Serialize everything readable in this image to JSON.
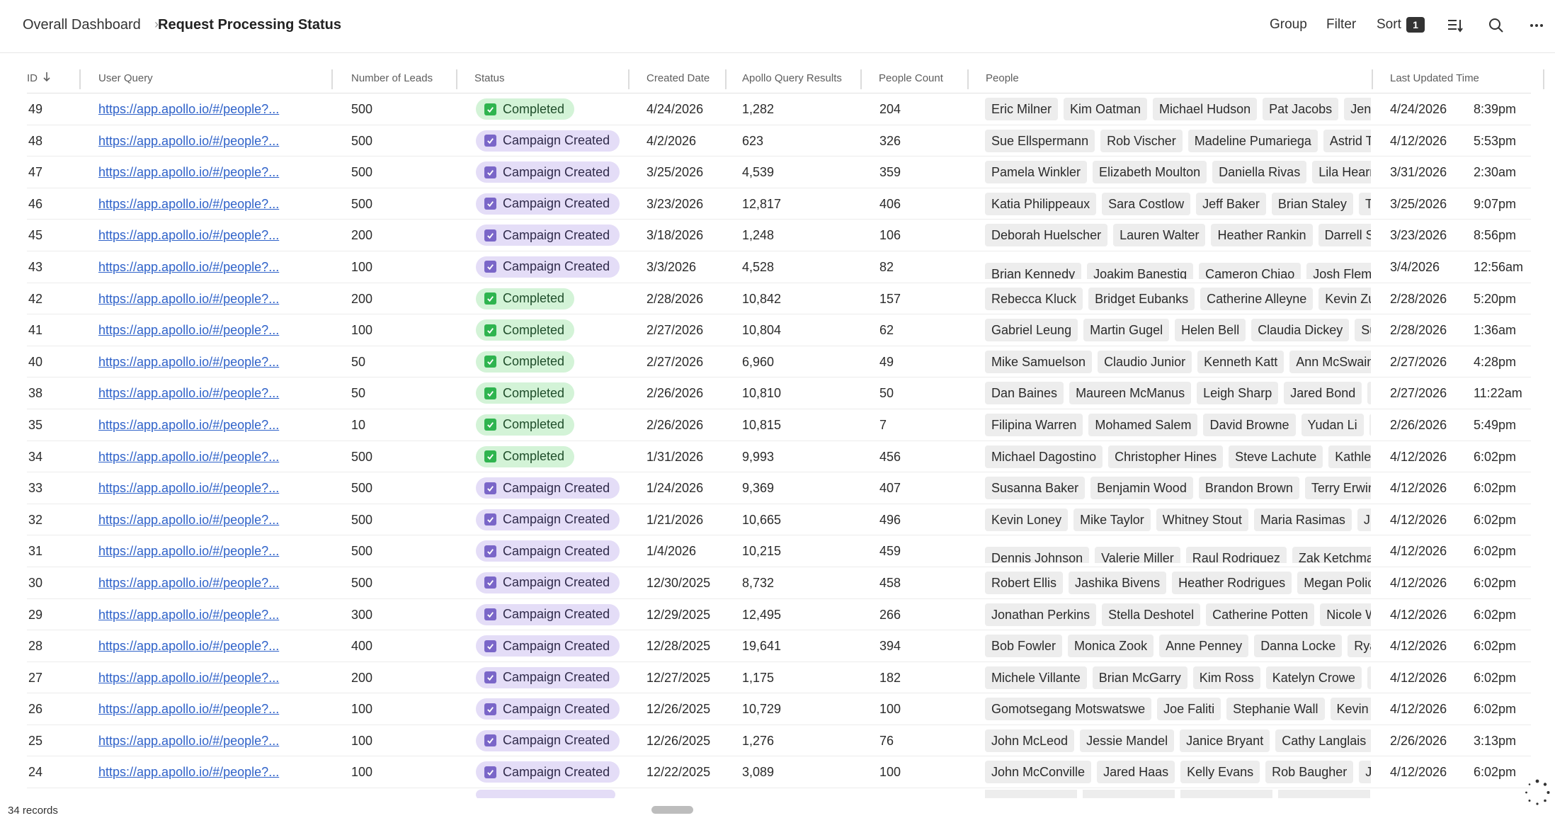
{
  "breadcrumb": {
    "root": "Overall Dashboard",
    "separator": "›",
    "current": "Request Processing Status"
  },
  "toolbar": {
    "group": "Group",
    "filter": "Filter",
    "sort": "Sort",
    "sort_count": "1",
    "icons": [
      "row-height-icon",
      "search-icon",
      "more-icon"
    ]
  },
  "table": {
    "columns": [
      "ID",
      "User Query",
      "Number of Leads",
      "Status",
      "Created Date",
      "Apollo Query Results",
      "People Count",
      "People",
      "Last Updated Time"
    ],
    "rows": [
      {
        "id": "49",
        "query": "https://app.apollo.io/#/people?...",
        "leads": "500",
        "status": "Completed",
        "created": "4/24/2026",
        "results": "1,282",
        "count": "204",
        "people": [
          "Eric Milner",
          "Kim Oatman",
          "Michael Hudson",
          "Pat Jacobs",
          "Jenna Ca"
        ],
        "updated_date": "4/24/2026",
        "updated_time": "8:39pm"
      },
      {
        "id": "48",
        "query": "https://app.apollo.io/#/people?...",
        "leads": "500",
        "status": "Campaign Created",
        "created": "4/2/2026",
        "results": "623",
        "count": "326",
        "people": [
          "Sue Ellspermann",
          "Rob Vischer",
          "Madeline Pumariega",
          "Astrid Tumir"
        ],
        "updated_date": "4/12/2026",
        "updated_time": "5:53pm"
      },
      {
        "id": "47",
        "query": "https://app.apollo.io/#/people?...",
        "leads": "500",
        "status": "Campaign Created",
        "created": "3/25/2026",
        "results": "4,539",
        "count": "359",
        "people": [
          "Pamela Winkler",
          "Elizabeth Moulton",
          "Daniella Rivas",
          "Lila Hearn",
          "P"
        ],
        "updated_date": "3/31/2026",
        "updated_time": "2:30am"
      },
      {
        "id": "46",
        "query": "https://app.apollo.io/#/people?...",
        "leads": "500",
        "status": "Campaign Created",
        "created": "3/23/2026",
        "results": "12,817",
        "count": "406",
        "people": [
          "Katia Philippeaux",
          "Sara Costlow",
          "Jeff Baker",
          "Brian Staley",
          "Tyler Ja"
        ],
        "updated_date": "3/25/2026",
        "updated_time": "9:07pm"
      },
      {
        "id": "45",
        "query": "https://app.apollo.io/#/people?...",
        "leads": "200",
        "status": "Campaign Created",
        "created": "3/18/2026",
        "results": "1,248",
        "count": "106",
        "people": [
          "Deborah Huelscher",
          "Lauren Walter",
          "Heather Rankin",
          "Darrell Stinch"
        ],
        "updated_date": "3/23/2026",
        "updated_time": "8:56pm"
      },
      {
        "id": "43",
        "query": "https://app.apollo.io/#/people?...",
        "leads": "100",
        "status": "Campaign Created",
        "created": "3/3/2026",
        "results": "4,528",
        "count": "82",
        "people": [
          "Brian Kennedy",
          "Joakim Banestig",
          "Cameron Chiao",
          "Josh Fleming",
          ""
        ],
        "updated_date": "3/4/2026",
        "updated_time": "12:56am"
      },
      {
        "id": "42",
        "query": "https://app.apollo.io/#/people?...",
        "leads": "200",
        "status": "Completed",
        "created": "2/28/2026",
        "results": "10,842",
        "count": "157",
        "people": [
          "Rebecca Kluck",
          "Bridget Eubanks",
          "Catherine Alleyne",
          "Kevin Zuchor"
        ],
        "updated_date": "2/28/2026",
        "updated_time": "5:20pm"
      },
      {
        "id": "41",
        "query": "https://app.apollo.io/#/people?...",
        "leads": "100",
        "status": "Completed",
        "created": "2/27/2026",
        "results": "10,804",
        "count": "62",
        "people": [
          "Gabriel Leung",
          "Martin Gugel",
          "Helen Bell",
          "Claudia Dickey",
          "Susan"
        ],
        "updated_date": "2/28/2026",
        "updated_time": "1:36am"
      },
      {
        "id": "40",
        "query": "https://app.apollo.io/#/people?...",
        "leads": "50",
        "status": "Completed",
        "created": "2/27/2026",
        "results": "6,960",
        "count": "49",
        "people": [
          "Mike Samuelson",
          "Claudio Junior",
          "Kenneth Katt",
          "Ann McSwain",
          "J"
        ],
        "updated_date": "2/27/2026",
        "updated_time": "4:28pm"
      },
      {
        "id": "38",
        "query": "https://app.apollo.io/#/people?...",
        "leads": "50",
        "status": "Completed",
        "created": "2/26/2026",
        "results": "10,810",
        "count": "50",
        "people": [
          "Dan Baines",
          "Maureen McManus",
          "Leigh Sharp",
          "Jared Bond",
          "Firoz"
        ],
        "updated_date": "2/27/2026",
        "updated_time": "11:22am"
      },
      {
        "id": "35",
        "query": "https://app.apollo.io/#/people?...",
        "leads": "10",
        "status": "Completed",
        "created": "2/26/2026",
        "results": "10,815",
        "count": "7",
        "people": [
          "Filipina Warren",
          "Mohamed Salem",
          "David Browne",
          "Yudan Li",
          "Allis"
        ],
        "updated_date": "2/26/2026",
        "updated_time": "5:49pm"
      },
      {
        "id": "34",
        "query": "https://app.apollo.io/#/people?...",
        "leads": "500",
        "status": "Completed",
        "created": "1/31/2026",
        "results": "9,993",
        "count": "456",
        "people": [
          "Michael Dagostino",
          "Christopher Hines",
          "Steve Lachute",
          "Kathleen M"
        ],
        "updated_date": "4/12/2026",
        "updated_time": "6:02pm"
      },
      {
        "id": "33",
        "query": "https://app.apollo.io/#/people?...",
        "leads": "500",
        "status": "Campaign Created",
        "created": "1/24/2026",
        "results": "9,369",
        "count": "407",
        "people": [
          "Susanna Baker",
          "Benjamin Wood",
          "Brandon Brown",
          "Terry Erwin",
          "Jo"
        ],
        "updated_date": "4/12/2026",
        "updated_time": "6:02pm"
      },
      {
        "id": "32",
        "query": "https://app.apollo.io/#/people?...",
        "leads": "500",
        "status": "Campaign Created",
        "created": "1/21/2026",
        "results": "10,665",
        "count": "496",
        "people": [
          "Kevin Loney",
          "Mike Taylor",
          "Whitney Stout",
          "Maria Rasimas",
          "Judy F"
        ],
        "updated_date": "4/12/2026",
        "updated_time": "6:02pm"
      },
      {
        "id": "31",
        "query": "https://app.apollo.io/#/people?...",
        "leads": "500",
        "status": "Campaign Created",
        "created": "1/4/2026",
        "results": "10,215",
        "count": "459",
        "people": [
          "Dennis Johnson",
          "Valerie Miller",
          "Raul Rodriguez",
          "Zak Ketchmark",
          ""
        ],
        "updated_date": "4/12/2026",
        "updated_time": "6:02pm"
      },
      {
        "id": "30",
        "query": "https://app.apollo.io/#/people?...",
        "leads": "500",
        "status": "Campaign Created",
        "created": "12/30/2025",
        "results": "8,732",
        "count": "458",
        "people": [
          "Robert Ellis",
          "Jashika Bivens",
          "Heather Rodrigues",
          "Megan Policicchio"
        ],
        "updated_date": "4/12/2026",
        "updated_time": "6:02pm"
      },
      {
        "id": "29",
        "query": "https://app.apollo.io/#/people?...",
        "leads": "300",
        "status": "Campaign Created",
        "created": "12/29/2025",
        "results": "12,495",
        "count": "266",
        "people": [
          "Jonathan Perkins",
          "Stella Deshotel",
          "Catherine Potten",
          "Nicole Wyse"
        ],
        "updated_date": "4/12/2026",
        "updated_time": "6:02pm"
      },
      {
        "id": "28",
        "query": "https://app.apollo.io/#/people?...",
        "leads": "400",
        "status": "Campaign Created",
        "created": "12/28/2025",
        "results": "19,641",
        "count": "394",
        "people": [
          "Bob Fowler",
          "Monica Zook",
          "Anne Penney",
          "Danna Locke",
          "Ryan Sn"
        ],
        "updated_date": "4/12/2026",
        "updated_time": "6:02pm"
      },
      {
        "id": "27",
        "query": "https://app.apollo.io/#/people?...",
        "leads": "200",
        "status": "Campaign Created",
        "created": "12/27/2025",
        "results": "1,175",
        "count": "182",
        "people": [
          "Michele Villante",
          "Brian McGarry",
          "Kim Ross",
          "Katelyn Crowe",
          "Jim M"
        ],
        "updated_date": "4/12/2026",
        "updated_time": "6:02pm"
      },
      {
        "id": "26",
        "query": "https://app.apollo.io/#/people?...",
        "leads": "100",
        "status": "Campaign Created",
        "created": "12/26/2025",
        "results": "10,729",
        "count": "100",
        "people": [
          "Gomotsegang Motswatswe",
          "Joe Faliti",
          "Stephanie Wall",
          "Kevin Haag"
        ],
        "updated_date": "4/12/2026",
        "updated_time": "6:02pm"
      },
      {
        "id": "25",
        "query": "https://app.apollo.io/#/people?...",
        "leads": "100",
        "status": "Campaign Created",
        "created": "12/26/2025",
        "results": "1,276",
        "count": "76",
        "people": [
          "John McLeod",
          "Jessie Mandel",
          "Janice Bryant",
          "Cathy Langlais",
          "Jose"
        ],
        "updated_date": "2/26/2026",
        "updated_time": "3:13pm"
      },
      {
        "id": "24",
        "query": "https://app.apollo.io/#/people?...",
        "leads": "100",
        "status": "Campaign Created",
        "created": "12/22/2025",
        "results": "3,089",
        "count": "100",
        "people": [
          "John McConville",
          "Jared Haas",
          "Kelly Evans",
          "Rob Baugher",
          "Jason W"
        ],
        "updated_date": "4/12/2026",
        "updated_time": "6:02pm"
      }
    ]
  },
  "footer": {
    "records": "34 records"
  },
  "colors": {
    "completed_bg": "#d3f3d7",
    "completed_check": "#2fb44f",
    "campaign_bg": "#e4ddf7",
    "campaign_check": "#7a66c8",
    "link": "#2f62c9"
  }
}
